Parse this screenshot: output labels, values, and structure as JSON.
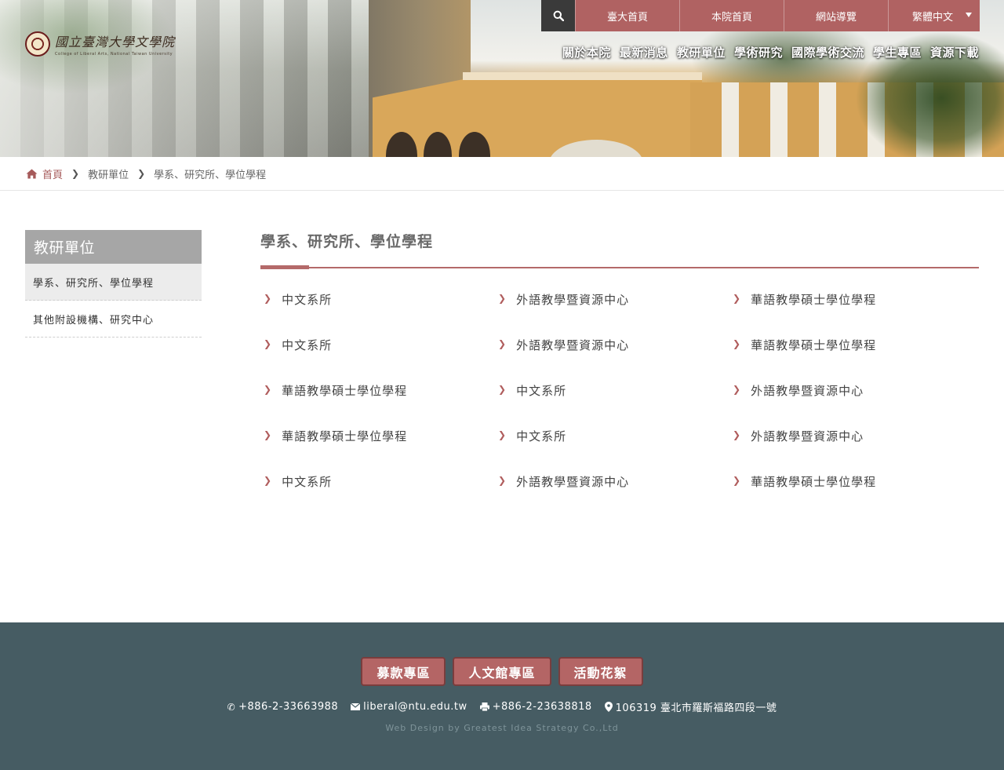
{
  "logo": {
    "main": "國立臺灣大學文學院",
    "sub": "College of Liberal Arts, National Taiwan University"
  },
  "topbar": {
    "items": [
      "臺大首頁",
      "本院首頁",
      "網站導覽"
    ],
    "language": "繁體中文"
  },
  "nav": [
    "關於本院",
    "最新消息",
    "教研單位",
    "學術研究",
    "國際學術交流",
    "學生專區",
    "資源下載"
  ],
  "breadcrumb": {
    "home": "首頁",
    "level1": "教研單位",
    "level2": "學系、研究所、學位學程"
  },
  "sidebar": {
    "title": "教研單位",
    "items": [
      {
        "label": "學系、研究所、學位學程",
        "active": true
      },
      {
        "label": "其他附設機構、研究中心",
        "active": false
      }
    ]
  },
  "content": {
    "title": "學系、研究所、學位學程",
    "links": [
      "中文系所",
      "外語教學暨資源中心",
      "華語教學碩士學位學程",
      "中文系所",
      "外語教學暨資源中心",
      "華語教學碩士學位學程",
      "華語教學碩士學位學程",
      "中文系所",
      "外語教學暨資源中心",
      "華語教學碩士學位學程",
      "中文系所",
      "外語教學暨資源中心",
      "中文系所",
      "外語教學暨資源中心",
      "華語教學碩士學位學程"
    ]
  },
  "footer": {
    "buttons": [
      "募款專區",
      "人文館專區",
      "活動花絮"
    ],
    "phone": "+886-2-33663988",
    "email": "liberal@ntu.edu.tw",
    "fax": "+886-2-23638818",
    "address": "106319 臺北市羅斯福路四段一號",
    "credit": "Web Design by Greatest Idea Strategy Co.,Ltd"
  },
  "colors": {
    "accent": "#b06262",
    "footer": "#465c63",
    "sidebar_title": "#a6a6a6"
  }
}
